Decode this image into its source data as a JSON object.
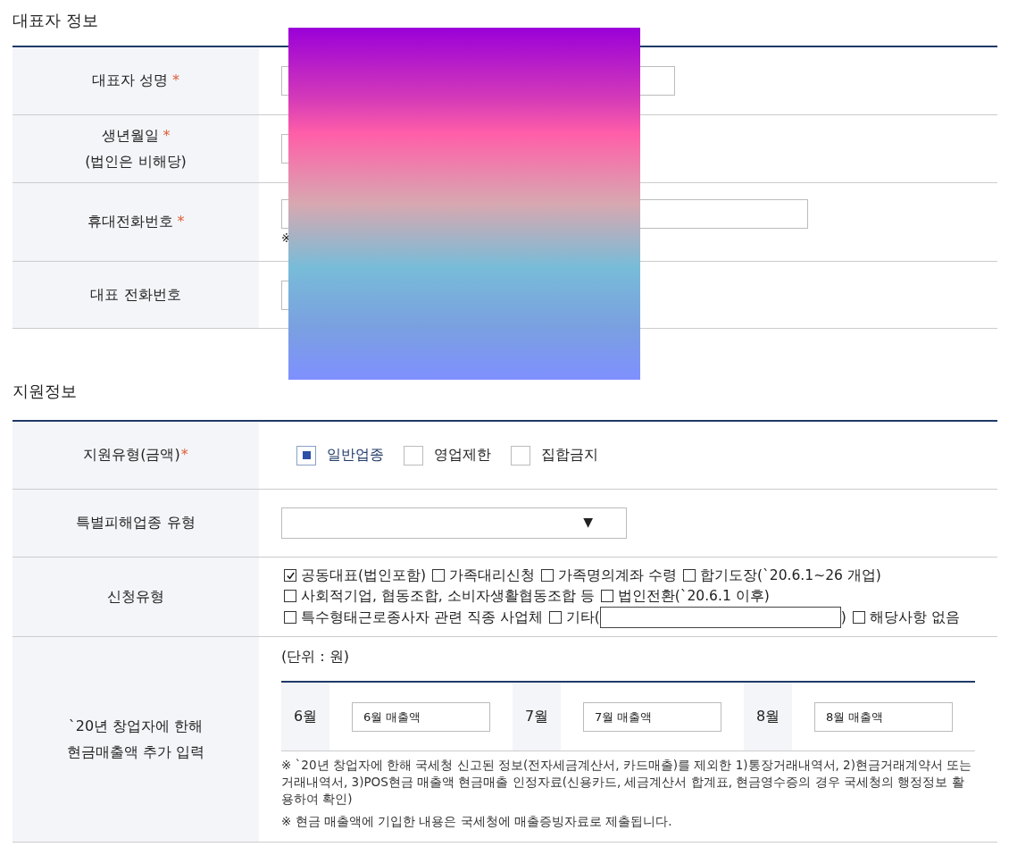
{
  "representative": {
    "title": "대표자 정보",
    "rows": [
      {
        "kind": "name",
        "label": "대표자 성명",
        "mark": "*"
      },
      {
        "kind": "birth",
        "label": "생년월일",
        "mark": "*",
        "sublabel": "(법인은 비해당)"
      },
      {
        "kind": "mobile",
        "label": "휴대전화번호",
        "mark": "*",
        "note_mark": "※"
      },
      {
        "kind": "tel",
        "label": "대표 전화번호"
      }
    ]
  },
  "support": {
    "title": "지원정보",
    "type_row": {
      "label": "지원유형(금액)",
      "mark": "*",
      "options": [
        {
          "label": "일반업종",
          "selected": true
        },
        {
          "label": "영업제한",
          "selected": false
        },
        {
          "label": "집합금지",
          "selected": false
        }
      ]
    },
    "special_row": {
      "label": "특별피해업종 유형",
      "arrow": "▼"
    },
    "apply_row": {
      "label": "신청유형",
      "lines": [
        [
          {
            "kind": "check",
            "label": "공동대표(법인포함)",
            "checked": true
          },
          {
            "kind": "check",
            "label": "가족대리신청",
            "checked": false
          },
          {
            "kind": "check",
            "label": "가족명의계좌 수령",
            "checked": false
          },
          {
            "kind": "check",
            "label": "합기도장(`20.6.1~26 개업)",
            "checked": false
          }
        ],
        [
          {
            "kind": "check",
            "label": "사회적기업, 협동조합, 소비자생활협동조합 등",
            "checked": false
          },
          {
            "kind": "check",
            "label": "법인전환(`20.6.1 이후)",
            "checked": false
          }
        ],
        [
          {
            "kind": "check",
            "label": "특수형태근로종사자 관련 직종 사업체",
            "checked": false
          },
          {
            "kind": "check",
            "label": "기타(",
            "checked": false
          },
          {
            "kind": "field"
          },
          {
            "kind": "text",
            "label": ")"
          },
          {
            "kind": "check",
            "label": "해당사항 없음",
            "checked": false
          }
        ]
      ]
    },
    "sales_row": {
      "label": "`20년 창업자에 한해",
      "sublabel": "현금매출액 추가 입력",
      "unit": "(단위 : 원)",
      "months": [
        {
          "month": "6월",
          "placeholder": "6월 매출액"
        },
        {
          "month": "7월",
          "placeholder": "7월 매출액"
        },
        {
          "month": "8월",
          "placeholder": "8월 매출액"
        }
      ],
      "notes": [
        "※ `20년 창업자에 한해 국세청 신고된 정보(전자세금계산서, 카드매출)를 제외한 1)통장거래내역서, 2)현금거래계약서 또는 거래내역서, 3)POS현금 매출액 현금매출 인정자료(신용카드, 세금계산서 합계표, 현금영수증의 경우 국세청의 행정정보 활용하여 확인)",
        "※ 현금 매출액에 기입한 내용은 국세청에 매출증빙자료로 제출됩니다."
      ]
    }
  }
}
